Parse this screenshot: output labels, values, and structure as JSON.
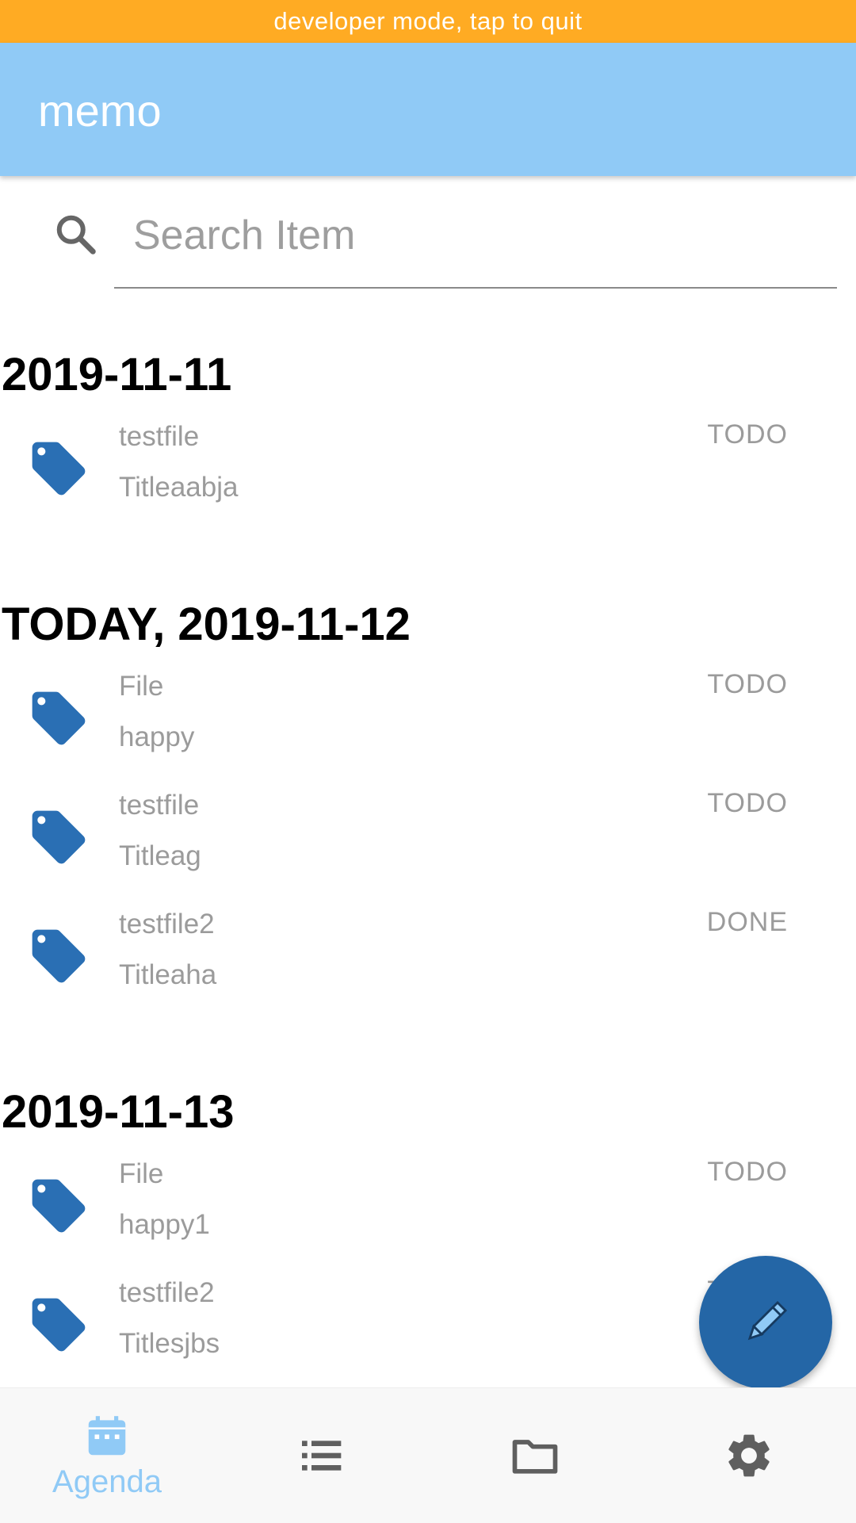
{
  "dev_banner": {
    "text": "developer mode, tap to quit"
  },
  "appbar": {
    "title": "memo"
  },
  "search": {
    "placeholder": "Search Item"
  },
  "groups": [
    {
      "date": "2019-11-11",
      "items": [
        {
          "file": "testfile",
          "title": "Titleaabja",
          "state": "TODO"
        }
      ]
    },
    {
      "date": "TODAY, 2019-11-12",
      "items": [
        {
          "file": "File",
          "title": "happy",
          "state": "TODO"
        },
        {
          "file": "testfile",
          "title": "Titleag",
          "state": "TODO"
        },
        {
          "file": "testfile2",
          "title": "Titleaha",
          "state": "DONE"
        }
      ]
    },
    {
      "date": "2019-11-13",
      "items": [
        {
          "file": "File",
          "title": "happy1",
          "state": "TODO"
        },
        {
          "file": "testfile2",
          "title": "Titlesjbs",
          "state": "TODO"
        }
      ]
    }
  ],
  "fab": {
    "icon": "pencil-icon"
  },
  "bottom_nav": {
    "items": [
      {
        "icon": "calendar-icon",
        "label": "Agenda",
        "active": true
      },
      {
        "icon": "list-icon",
        "label": "",
        "active": false
      },
      {
        "icon": "folder-icon",
        "label": "",
        "active": false
      },
      {
        "icon": "gear-icon",
        "label": "",
        "active": false
      }
    ]
  },
  "colors": {
    "dev_banner": "#ffab23",
    "appbar": "#90caf6",
    "accent": "#2466a6",
    "tag": "#2a6fb4",
    "secondary_text": "#9b9b9b",
    "nav_inactive": "#5f5f5f"
  }
}
